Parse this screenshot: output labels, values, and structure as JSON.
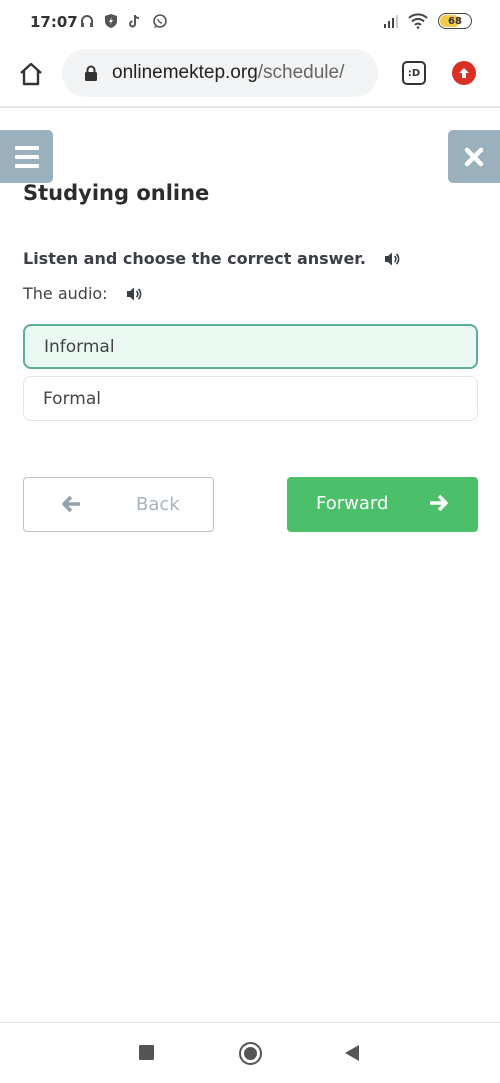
{
  "status_bar": {
    "time": "17:07",
    "left_icons": [
      "headphones-icon",
      "shield-icon",
      "tiktok-icon",
      "whatsapp-icon"
    ],
    "battery_level": "68",
    "battery_fraction": 0.68
  },
  "browser": {
    "url_domain": "onlinemektep.org",
    "url_path": "/schedule/",
    "tab_label": ":D"
  },
  "page": {
    "title": "Studying online",
    "instruction": "Listen and choose the correct answer.",
    "audio_label": "The audio:",
    "options": [
      {
        "label": "Informal",
        "selected": true
      },
      {
        "label": "Formal",
        "selected": false
      }
    ],
    "back_label": "Back",
    "forward_label": "Forward"
  },
  "colors": {
    "sidebar_button": "#9ab0bd",
    "selected_option_bg": "#eaf8f2",
    "selected_option_border": "#5fac98",
    "forward_button": "#4cbf6b",
    "update_badge": "#d93025"
  }
}
